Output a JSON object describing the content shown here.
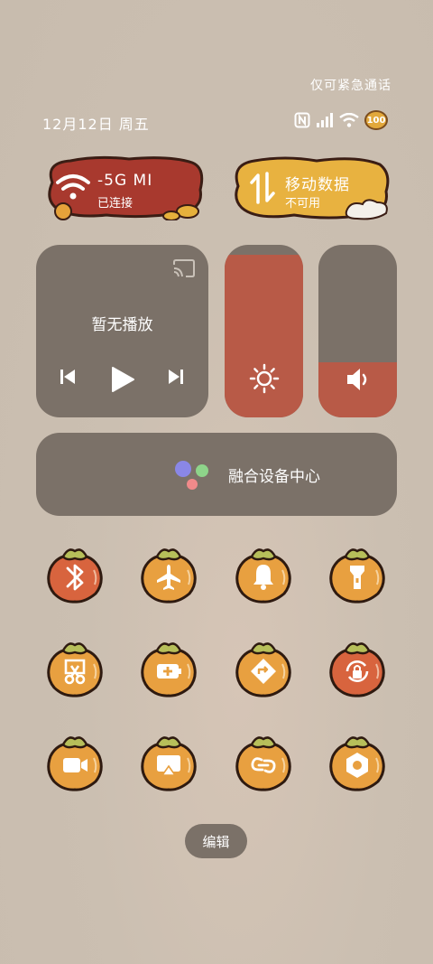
{
  "status_bar": {
    "emergency": "仅可紧急通话",
    "date": "12月12日 周五",
    "battery": "100"
  },
  "wifi_tile": {
    "name": "-5G   MI",
    "status": "已连接"
  },
  "mobile_data_tile": {
    "name": "移动数据",
    "status": "不可用"
  },
  "media": {
    "title": "暂无播放"
  },
  "brightness": {
    "level": 0.94
  },
  "volume": {
    "level": 0.32
  },
  "device_hub": {
    "label": "融合设备中心"
  },
  "toggles": [
    {
      "icon": "bluetooth-icon",
      "active": false
    },
    {
      "icon": "airplane-icon",
      "active": true
    },
    {
      "icon": "bell-icon",
      "active": true
    },
    {
      "icon": "flashlight-icon",
      "active": true
    },
    {
      "icon": "screenshot-icon",
      "active": true
    },
    {
      "icon": "battery-saver-icon",
      "active": true
    },
    {
      "icon": "location-icon",
      "active": true
    },
    {
      "icon": "rotation-lock-icon",
      "active": false
    },
    {
      "icon": "screen-record-icon",
      "active": true
    },
    {
      "icon": "screen-cast-icon",
      "active": true
    },
    {
      "icon": "link-icon",
      "active": true
    },
    {
      "icon": "settings-icon",
      "active": true
    }
  ],
  "edit_button": "编辑",
  "colors": {
    "persimmon_on": "#e8a040",
    "persimmon_off": "#d8643e",
    "card": "#7b7168",
    "accent": "#b85a47"
  }
}
